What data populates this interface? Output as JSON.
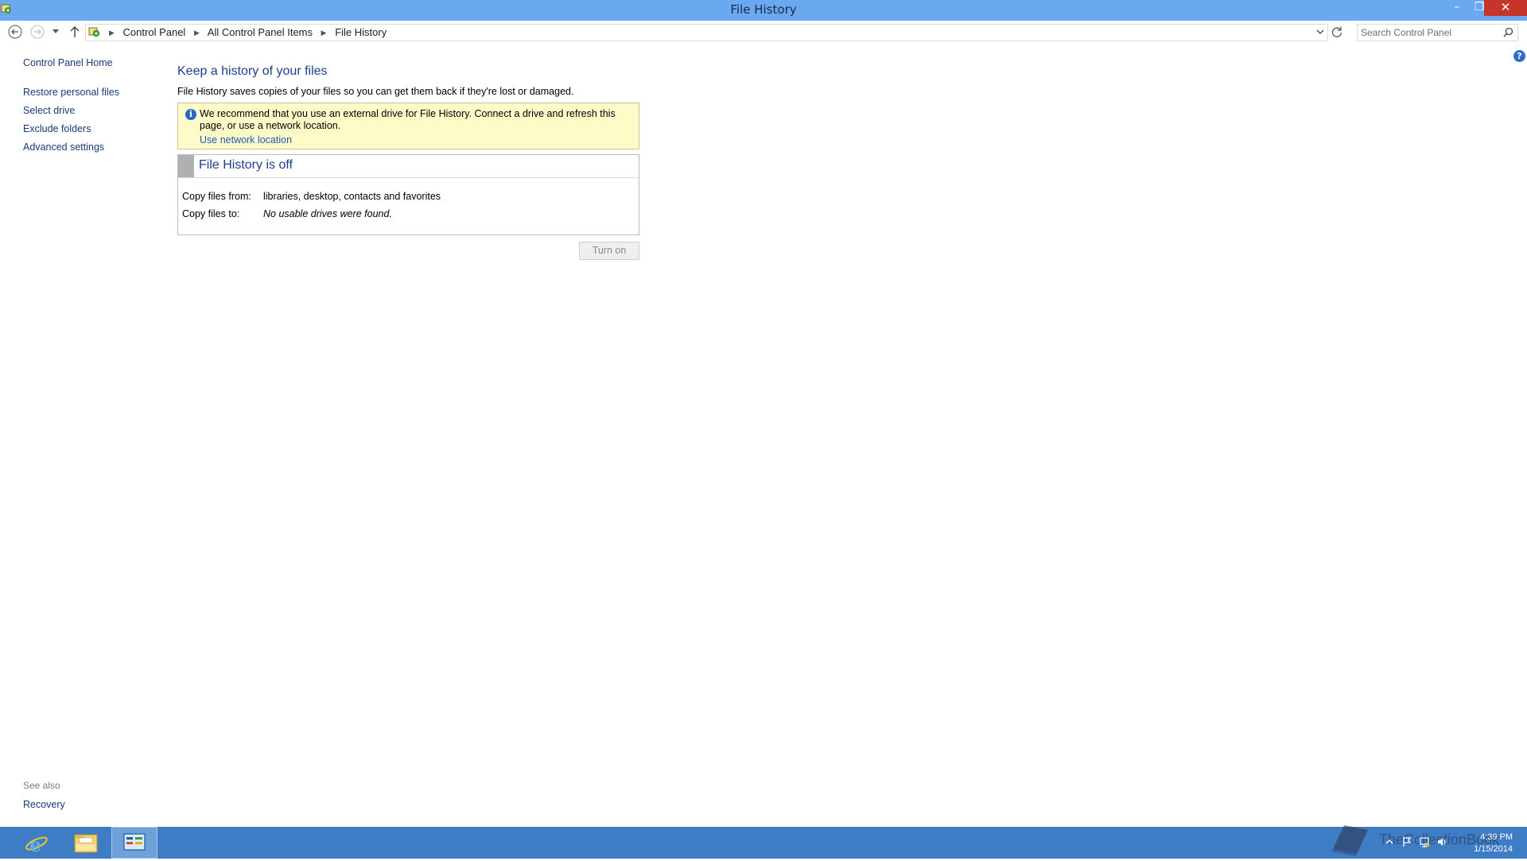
{
  "window": {
    "title": "File History",
    "controls": {
      "minimize": "–",
      "restore": "❒",
      "close": "✕"
    }
  },
  "address_bar": {
    "breadcrumbs": [
      "Control Panel",
      "All Control Panel Items",
      "File History"
    ],
    "search_placeholder": "Search Control Panel"
  },
  "sidebar": {
    "home": "Control Panel Home",
    "items": [
      "Restore personal files",
      "Select drive",
      "Exclude folders",
      "Advanced settings"
    ],
    "see_also_label": "See also",
    "see_also_items": [
      "Recovery"
    ]
  },
  "main": {
    "title": "Keep a history of your files",
    "description": "File History saves copies of your files so you can get them back if they're lost or damaged.",
    "info": {
      "message": "We recommend that you use an external drive for File History. Connect a drive and refresh this page, or use a network location.",
      "link": "Use network location"
    },
    "status": {
      "title": "File History is off",
      "copy_from_label": "Copy files from:",
      "copy_from_value": "libraries, desktop, contacts and favorites",
      "copy_to_label": "Copy files to:",
      "copy_to_value": "No usable drives were found."
    },
    "turn_on_button": "Turn on"
  },
  "taskbar": {
    "clock_time": "4:39 PM",
    "clock_date": "1/15/2014",
    "watermark": "TheCollectionBook"
  },
  "colors": {
    "titlebar": "#6aa8f0",
    "close_button": "#c7342a",
    "taskbar": "#3f7cc6",
    "link": "#1a3a78",
    "heading": "#1e3f8a",
    "info_background": "#fdfbc8"
  },
  "icons": {
    "app": "control-panel-icon",
    "back": "back-arrow-icon",
    "forward": "forward-arrow-icon",
    "up": "up-arrow-icon",
    "refresh": "refresh-icon",
    "search": "search-icon",
    "help": "help-icon",
    "info": "info-icon"
  }
}
